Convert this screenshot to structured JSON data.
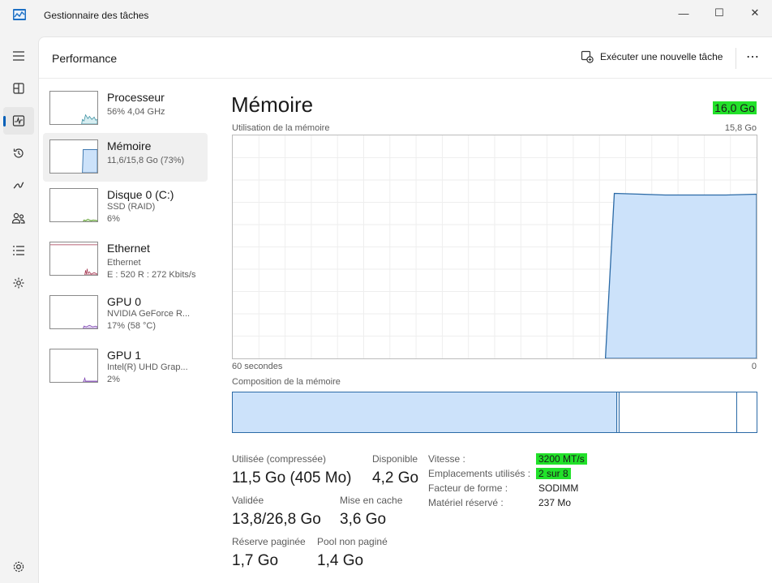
{
  "window": {
    "title": "Gestionnaire des tâches",
    "minimize_glyph": "—",
    "maximize_glyph": "☐",
    "close_glyph": "✕"
  },
  "rail": {
    "items": [
      "hamburger-icon",
      "processes-icon",
      "performance-icon",
      "history-icon",
      "startup-icon",
      "users-icon",
      "details-icon",
      "services-icon",
      "settings-icon"
    ],
    "active": "performance-icon"
  },
  "header": {
    "title": "Performance",
    "run_task_label": "Exécuter une nouvelle tâche",
    "more_label": "⋯"
  },
  "devices": [
    {
      "name": "Processeur",
      "line1": "56% 4,04 GHz",
      "line2": ""
    },
    {
      "name": "Mémoire",
      "line1": "11,6/15,8 Go (73%)",
      "line2": ""
    },
    {
      "name": "Disque 0 (C:)",
      "line1": "SSD (RAID)",
      "line2": "6%"
    },
    {
      "name": "Ethernet",
      "line1": "Ethernet",
      "line2": "E : 520 R : 272 Kbits/s"
    },
    {
      "name": "GPU 0",
      "line1": "NVIDIA GeForce R...",
      "line2": "17% (58 °C)"
    },
    {
      "name": "GPU 1",
      "line1": "Intel(R) UHD Grap...",
      "line2": "2%"
    }
  ],
  "detail": {
    "title": "Mémoire",
    "total": "16,0 Go",
    "usage_label": "Utilisation de la mémoire",
    "usage_max": "15,8 Go",
    "time_left": "60 secondes",
    "time_right": "0",
    "composition_label": "Composition de la mémoire",
    "usage_fraction": 0.73,
    "accent_color": "#2b6aa6",
    "fill_color": "#cce2fa",
    "highlight_color": "#22e12a"
  },
  "stats": {
    "used_label": "Utilisée (compressée)",
    "used_value": "11,5 Go (405 Mo)",
    "available_label": "Disponible",
    "available_value": "4,2 Go",
    "committed_label": "Validée",
    "committed_value": "13,8/26,8 Go",
    "cached_label": "Mise en cache",
    "cached_value": "3,6 Go",
    "paged_label": "Réserve paginée",
    "paged_value": "1,7 Go",
    "nonpaged_label": "Pool non paginé",
    "nonpaged_value": "1,4 Go"
  },
  "specs": {
    "speed_label": "Vitesse :",
    "speed_value": "3200 MT/s",
    "slots_label": "Emplacements utilisés :",
    "slots_value": "2 sur 8",
    "form_label": "Facteur de forme :",
    "form_value": "SODIMM",
    "reserved_label": "Matériel réservé :",
    "reserved_value": "237 Mo"
  }
}
